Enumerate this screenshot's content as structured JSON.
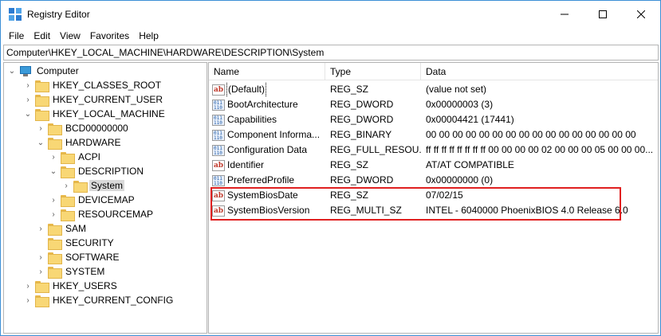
{
  "window": {
    "title": "Registry Editor"
  },
  "menu": [
    "File",
    "Edit",
    "View",
    "Favorites",
    "Help"
  ],
  "address": "Computer\\HKEY_LOCAL_MACHINE\\HARDWARE\\DESCRIPTION\\System",
  "tree": [
    {
      "label": "Computer",
      "icon": "computer-icon",
      "state": "expanded"
    },
    {
      "label": "HKEY_CLASSES_ROOT",
      "icon": "folder-icon",
      "state": "collapsed"
    },
    {
      "label": "HKEY_CURRENT_USER",
      "icon": "folder-icon",
      "state": "collapsed"
    },
    {
      "label": "HKEY_LOCAL_MACHINE",
      "icon": "folder-icon",
      "state": "expanded"
    },
    {
      "label": "BCD00000000",
      "icon": "folder-icon",
      "state": "collapsed"
    },
    {
      "label": "HARDWARE",
      "icon": "folder-icon",
      "state": "expanded"
    },
    {
      "label": "ACPI",
      "icon": "folder-icon",
      "state": "collapsed"
    },
    {
      "label": "DESCRIPTION",
      "icon": "folder-icon",
      "state": "expanded"
    },
    {
      "label": "System",
      "icon": "folder-icon",
      "state": "collapsed",
      "selected": true
    },
    {
      "label": "DEVICEMAP",
      "icon": "folder-icon",
      "state": "collapsed"
    },
    {
      "label": "RESOURCEMAP",
      "icon": "folder-icon",
      "state": "collapsed"
    },
    {
      "label": "SAM",
      "icon": "folder-icon",
      "state": "collapsed"
    },
    {
      "label": "SECURITY",
      "icon": "folder-icon",
      "state": "none"
    },
    {
      "label": "SOFTWARE",
      "icon": "folder-icon",
      "state": "collapsed"
    },
    {
      "label": "SYSTEM",
      "icon": "folder-icon",
      "state": "collapsed"
    },
    {
      "label": "HKEY_USERS",
      "icon": "folder-icon",
      "state": "collapsed"
    },
    {
      "label": "HKEY_CURRENT_CONFIG",
      "icon": "folder-icon",
      "state": "collapsed"
    }
  ],
  "columns": {
    "name": "Name",
    "type": "Type",
    "data": "Data"
  },
  "values": [
    {
      "name": "(Default)",
      "type": "REG_SZ",
      "data": "(value not set)",
      "icon": "string-value-icon"
    },
    {
      "name": "BootArchitecture",
      "type": "REG_DWORD",
      "data": "0x00000003 (3)",
      "icon": "binary-value-icon"
    },
    {
      "name": "Capabilities",
      "type": "REG_DWORD",
      "data": "0x00004421 (17441)",
      "icon": "binary-value-icon"
    },
    {
      "name": "Component Informa...",
      "type": "REG_BINARY",
      "data": "00 00 00 00 00 00 00 00 00 00 00 00 00 00 00 00",
      "icon": "binary-value-icon"
    },
    {
      "name": "Configuration Data",
      "type": "REG_FULL_RESOU...",
      "data": "ff ff ff ff ff ff ff ff 00 00 00 00 02 00 00 00 05 00 00 00...",
      "icon": "binary-value-icon"
    },
    {
      "name": "Identifier",
      "type": "REG_SZ",
      "data": "AT/AT COMPATIBLE",
      "icon": "string-value-icon"
    },
    {
      "name": "PreferredProfile",
      "type": "REG_DWORD",
      "data": "0x00000000 (0)",
      "icon": "binary-value-icon"
    },
    {
      "name": "SystemBiosDate",
      "type": "REG_SZ",
      "data": "07/02/15",
      "icon": "string-value-icon"
    },
    {
      "name": "SystemBiosVersion",
      "type": "REG_MULTI_SZ",
      "data": "INTEL  - 6040000 PhoenixBIOS 4.0 Release 6.0",
      "icon": "string-value-icon"
    }
  ],
  "highlight_color": "#e02020"
}
